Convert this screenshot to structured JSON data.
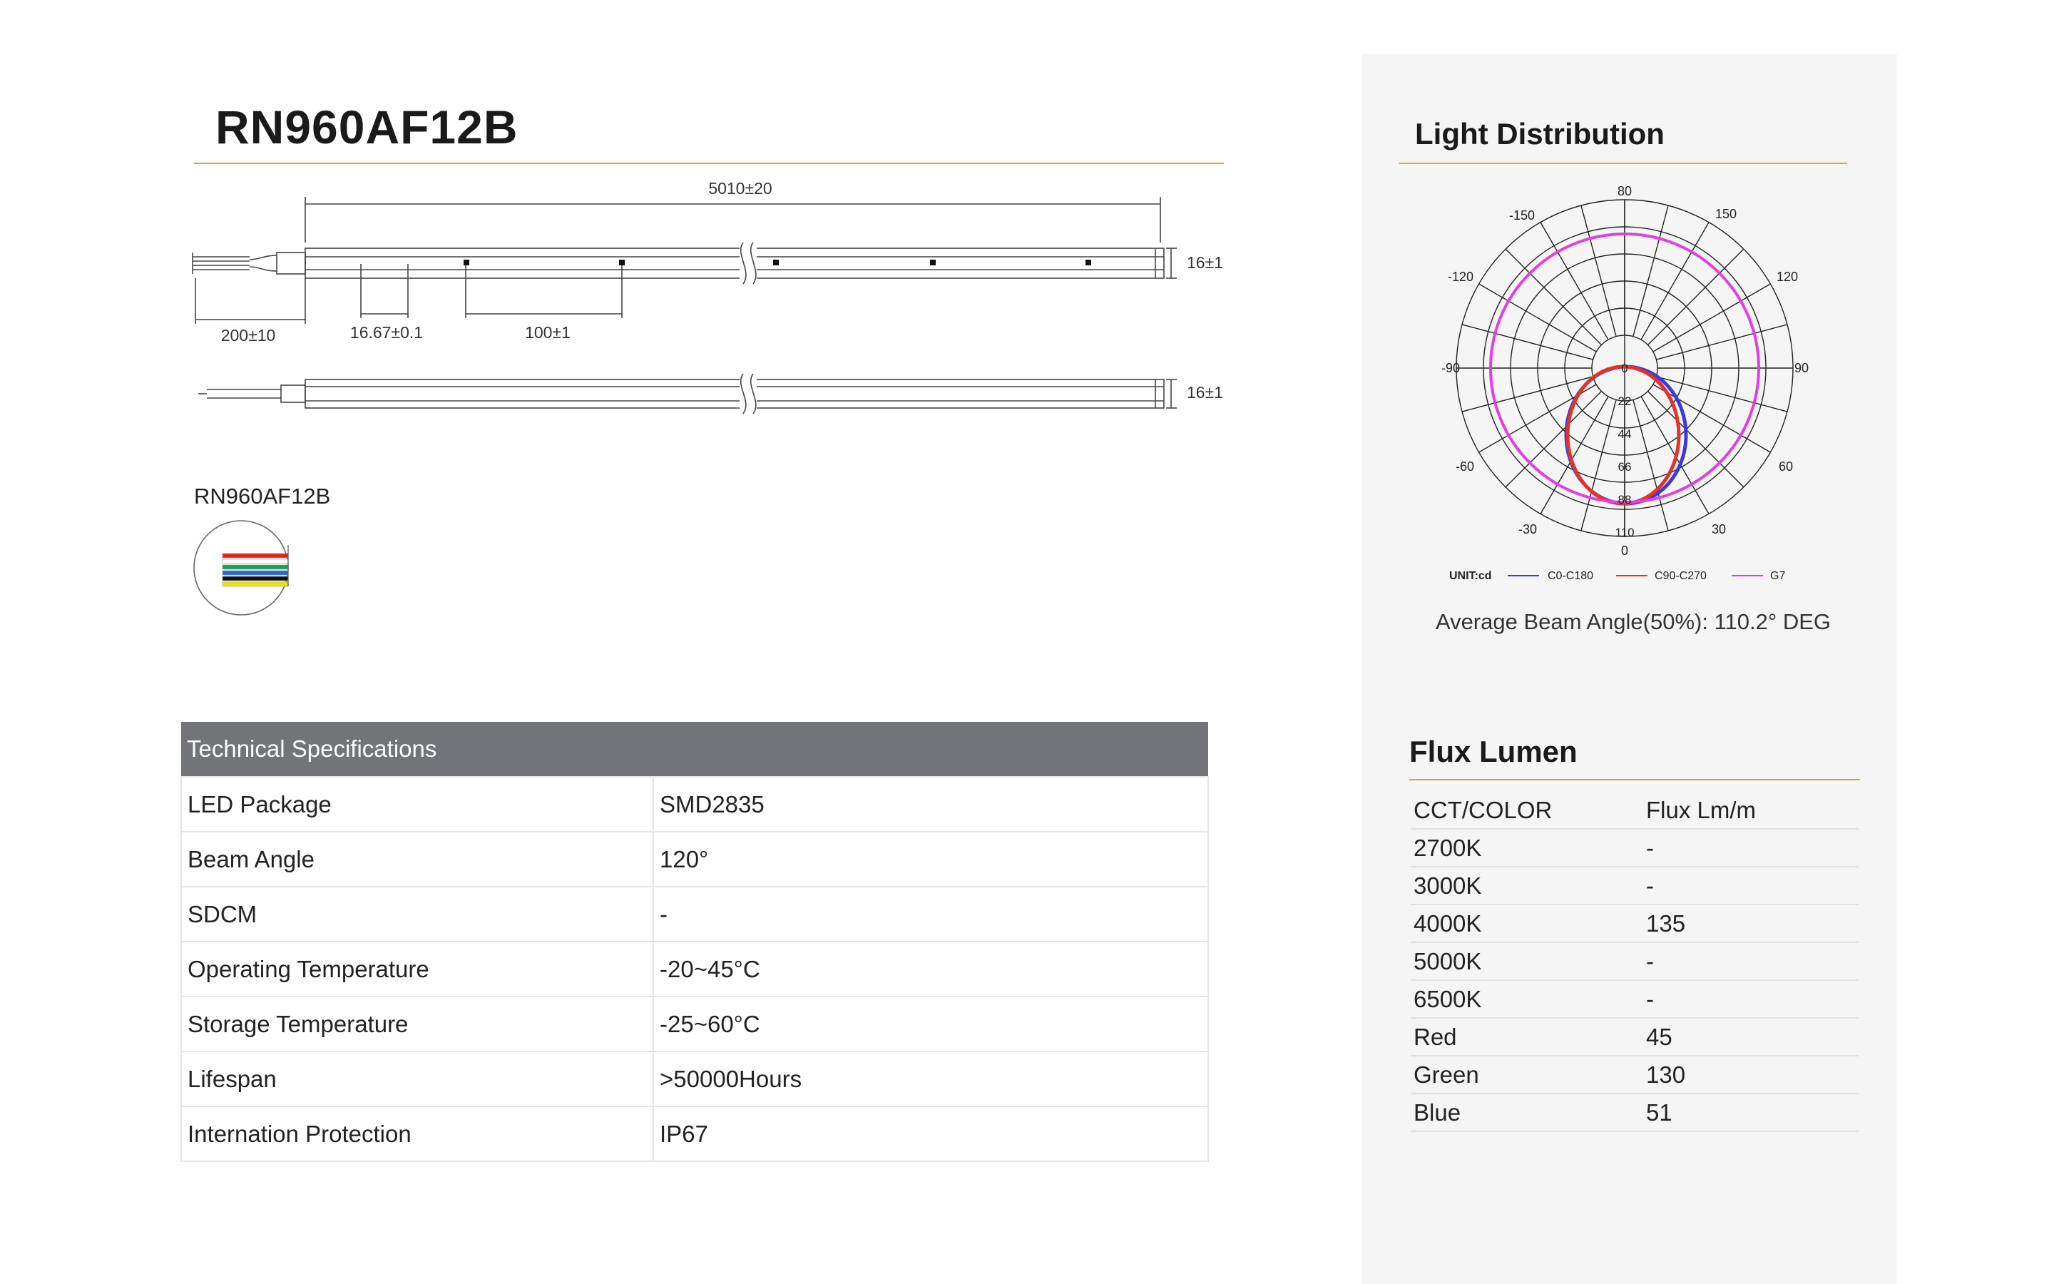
{
  "product": {
    "model": "RN960AF12B",
    "connector_label": "RN960AF12B"
  },
  "drawing": {
    "length": "5010±20",
    "height_top": "16±1",
    "height_bottom": "16±1",
    "cable_length": "200±10",
    "cut_unit": "16.67±0.1",
    "pitch": "100±1",
    "wire_colors": [
      "#e0221c",
      "#ffffff",
      "#16a34a",
      "#2563eb",
      "#111111",
      "#f2e600"
    ]
  },
  "specs": {
    "header": "Technical Specifications",
    "rows": [
      {
        "label": "LED Package",
        "value": "SMD2835"
      },
      {
        "label": "Beam Angle",
        "value": "120°"
      },
      {
        "label": "SDCM",
        "value": "-"
      },
      {
        "label": "Operating Temperature",
        "value": "-20~45°C"
      },
      {
        "label": "Storage Temperature",
        "value": "-25~60°C"
      },
      {
        "label": "Lifespan",
        "value": ">50000Hours"
      },
      {
        "label": "Internation Protection",
        "value": "IP67"
      }
    ]
  },
  "light_distribution": {
    "title": "Light Distribution",
    "angle_labels": {
      "top": "80",
      "upper_left": "-150",
      "upper_right": "150",
      "mid_left": "-120",
      "mid_right": "120",
      "left": "-90",
      "right": "90",
      "lower_left": "-60",
      "lower_right": "60",
      "bottom_left": "-30",
      "bottom_right": "30",
      "bottom": "0"
    },
    "radial_ticks": [
      "0",
      "22",
      "44",
      "66",
      "88",
      "110"
    ],
    "unit": "UNIT:cd",
    "legend": [
      {
        "name": "C0-C180",
        "color": "#3b3bd9"
      },
      {
        "name": "C90-C270",
        "color": "#e0342a"
      },
      {
        "name": "G7",
        "color": "#e040e0"
      }
    ],
    "beam_angle": "Average Beam Angle(50%): 110.2° DEG"
  },
  "flux": {
    "title": "Flux Lumen",
    "columns": [
      "CCT/COLOR",
      "Flux Lm/m"
    ],
    "rows": [
      [
        "2700K",
        "-"
      ],
      [
        "3000K",
        "-"
      ],
      [
        "4000K",
        "135"
      ],
      [
        "5000K",
        "-"
      ],
      [
        "6500K",
        "-"
      ],
      [
        "Red",
        "45"
      ],
      [
        "Green",
        "130"
      ],
      [
        "Blue",
        "51"
      ]
    ]
  }
}
